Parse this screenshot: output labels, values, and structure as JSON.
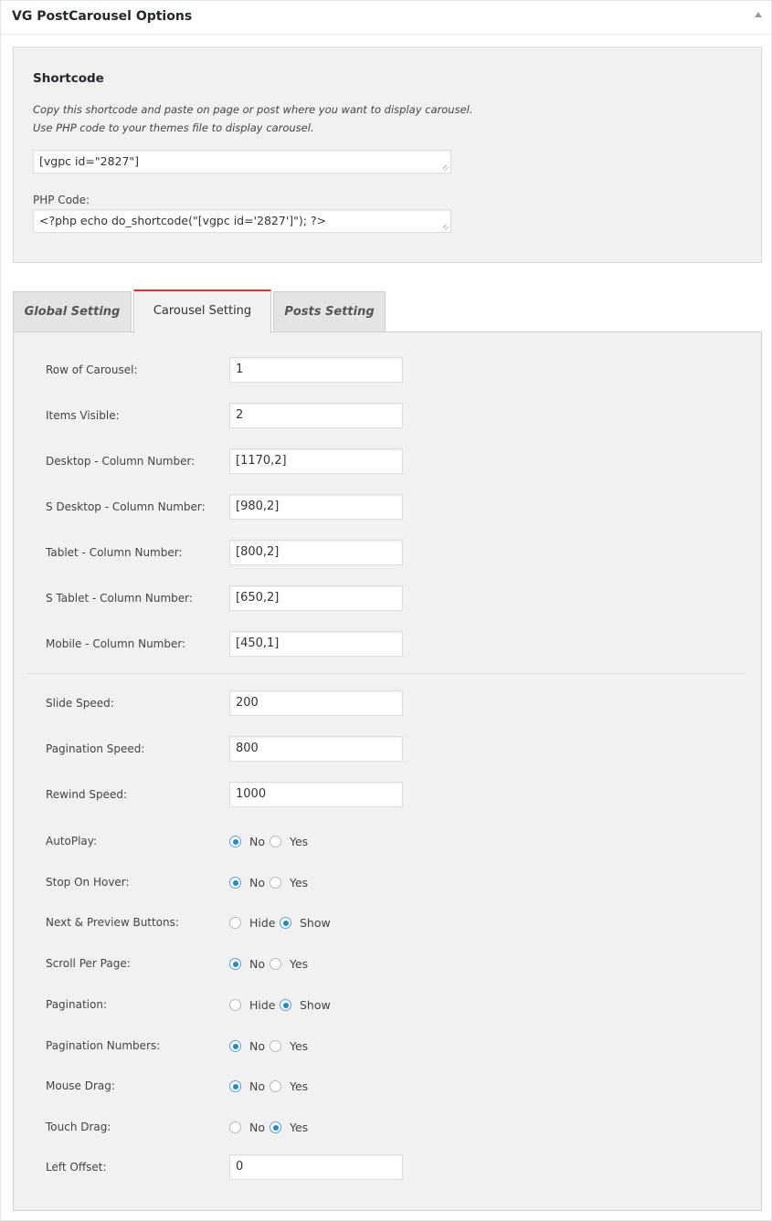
{
  "metabox": {
    "title": "VG PostCarousel Options"
  },
  "shortcode": {
    "title": "Shortcode",
    "desc_line1": "Copy this shortcode and paste on page or post where you want to display carousel.",
    "desc_line2": "Use PHP code to your themes file to display carousel.",
    "shortcode_value": "[vgpc id=\"2827\"]",
    "php_label": "PHP Code:",
    "php_value": "<?php echo do_shortcode(\"[vgpc id='2827']\"); ?>"
  },
  "tabs": {
    "global": "Global Setting",
    "carousel": "Carousel Setting",
    "posts": "Posts Setting"
  },
  "fields": {
    "row_of_carousel": {
      "label": "Row of Carousel:",
      "value": "1"
    },
    "items_visible": {
      "label": "Items Visible:",
      "value": "2"
    },
    "desktop_cols": {
      "label": "Desktop - Column Number:",
      "value": "[1170,2]"
    },
    "s_desktop_cols": {
      "label": "S Desktop - Column Number:",
      "value": "[980,2]"
    },
    "tablet_cols": {
      "label": "Tablet - Column Number:",
      "value": "[800,2]"
    },
    "s_tablet_cols": {
      "label": "S Tablet - Column Number:",
      "value": "[650,2]"
    },
    "mobile_cols": {
      "label": "Mobile - Column Number:",
      "value": "[450,1]"
    },
    "slide_speed": {
      "label": "Slide Speed:",
      "value": "200"
    },
    "pagination_speed": {
      "label": "Pagination Speed:",
      "value": "800"
    },
    "rewind_speed": {
      "label": "Rewind Speed:",
      "value": "1000"
    },
    "left_offset": {
      "label": "Left Offset:",
      "value": "0"
    }
  },
  "radios": {
    "autoplay": {
      "label": "AutoPlay:",
      "opt1": "No",
      "opt2": "Yes",
      "selected": "No"
    },
    "stop_on_hover": {
      "label": "Stop On Hover:",
      "opt1": "No",
      "opt2": "Yes",
      "selected": "No"
    },
    "next_prev": {
      "label": "Next & Preview Buttons:",
      "opt1": "Hide",
      "opt2": "Show",
      "selected": "Show"
    },
    "scroll_per_page": {
      "label": "Scroll Per Page:",
      "opt1": "No",
      "opt2": "Yes",
      "selected": "No"
    },
    "pagination": {
      "label": "Pagination:",
      "opt1": "Hide",
      "opt2": "Show",
      "selected": "Show"
    },
    "pagination_numbers": {
      "label": "Pagination Numbers:",
      "opt1": "No",
      "opt2": "Yes",
      "selected": "No"
    },
    "mouse_drag": {
      "label": "Mouse Drag:",
      "opt1": "No",
      "opt2": "Yes",
      "selected": "No"
    },
    "touch_drag": {
      "label": "Touch Drag:",
      "opt1": "No",
      "opt2": "Yes",
      "selected": "Yes"
    }
  },
  "colors": {
    "active_tab_accent": "#dd3333",
    "radio_checked": "#1e8cbe"
  }
}
